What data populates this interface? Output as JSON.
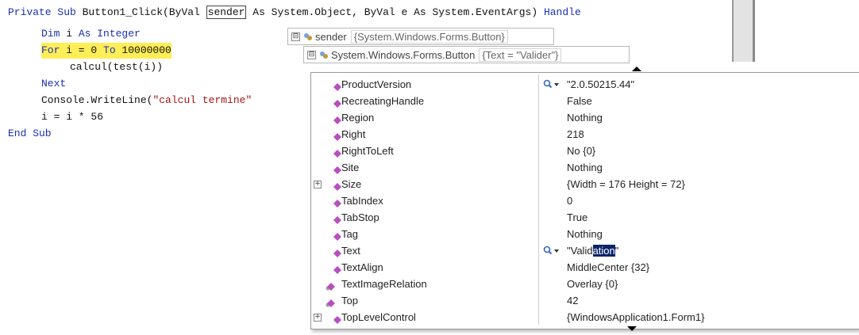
{
  "code": {
    "line1": {
      "kw1": "Private Sub",
      "t1": " Button1_Click(ByVal ",
      "sender": "sender",
      "t2": " As System.Object, ByVal e As System.EventArgs) ",
      "kw2": "Handle"
    },
    "line2": {
      "kw1": "Dim",
      "t1": " i ",
      "kw2": "As Integer"
    },
    "line3": {
      "kw1": "For",
      "t1": " i = 0 ",
      "kw2": "To",
      "t2": " 10000000"
    },
    "line4": "calcul(test(i))",
    "line5": "Next",
    "line6": {
      "t1": "Console.WriteLine(",
      "str": "\"calcul termine\""
    },
    "line7": "i = i * 56",
    "line8": "End Sub"
  },
  "tooltips": {
    "sender": {
      "name": "sender",
      "value": "{System.Windows.Forms.Button}"
    },
    "button": {
      "name": "System.Windows.Forms.Button",
      "value": "{Text = \"Valider\"}"
    }
  },
  "properties": [
    {
      "name": "ProductVersion",
      "value": "\"2.0.50215.44\"",
      "magnifier": true,
      "expandable": false,
      "icon": "property-icon"
    },
    {
      "name": "RecreatingHandle",
      "value": "False",
      "magnifier": false,
      "expandable": false,
      "icon": "property-icon"
    },
    {
      "name": "Region",
      "value": "Nothing",
      "magnifier": false,
      "expandable": false,
      "icon": "property-icon"
    },
    {
      "name": "Right",
      "value": "218",
      "magnifier": false,
      "expandable": false,
      "icon": "property-icon"
    },
    {
      "name": "RightToLeft",
      "value": "No {0}",
      "magnifier": false,
      "expandable": false,
      "icon": "property-icon"
    },
    {
      "name": "Site",
      "value": "Nothing",
      "magnifier": false,
      "expandable": false,
      "icon": "property-icon"
    },
    {
      "name": "Size",
      "value": "{Width = 176 Height = 72}",
      "magnifier": false,
      "expandable": true,
      "icon": "property-icon"
    },
    {
      "name": "TabIndex",
      "value": "0",
      "magnifier": false,
      "expandable": false,
      "icon": "property-icon"
    },
    {
      "name": "TabStop",
      "value": "True",
      "magnifier": false,
      "expandable": false,
      "icon": "property-icon"
    },
    {
      "name": "Tag",
      "value": "Nothing",
      "magnifier": false,
      "expandable": false,
      "icon": "property-icon"
    },
    {
      "name": "Text",
      "value_before": "\"Valid",
      "value_selected": "ation",
      "value_after": "\"",
      "magnifier": true,
      "expandable": false,
      "icon": "property-icon"
    },
    {
      "name": "TextAlign",
      "value": "MiddleCenter {32}",
      "magnifier": false,
      "expandable": false,
      "icon": "property-icon"
    },
    {
      "name": "TextImageRelation",
      "value": "Overlay {0}",
      "magnifier": false,
      "expandable": false,
      "icon": "inherited-property-icon"
    },
    {
      "name": "Top",
      "value": "42",
      "magnifier": false,
      "expandable": false,
      "icon": "inherited-property-icon"
    },
    {
      "name": "TopLevelControl",
      "value": "{WindowsApplication1.Form1}",
      "magnifier": false,
      "expandable": true,
      "icon": "property-icon"
    }
  ],
  "colors": {
    "keyword": "#1a2fb0",
    "string": "#a31515",
    "highlight": "#ffee57",
    "selection": "#0a246a",
    "property_icon": "#b84fc0"
  }
}
